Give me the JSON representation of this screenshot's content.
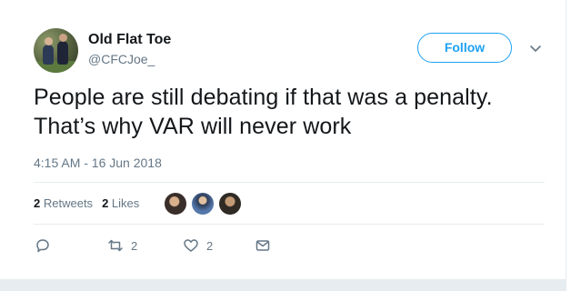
{
  "tweet": {
    "author_name": "Old Flat Toe",
    "author_handle": "@CFCJoe_",
    "follow_label": "Follow",
    "text": "People are still debating if that was a penalty. That’s why VAR will never work",
    "timestamp": "4:15 AM - 16 Jun 2018",
    "stats": {
      "retweets_count": "2",
      "retweets_label": "Retweets",
      "likes_count": "2",
      "likes_label": "Likes"
    },
    "actions": {
      "retweet_count": "2",
      "like_count": "2"
    }
  },
  "icons": {
    "reply": "reply-icon",
    "retweet": "retweet-icon",
    "like": "heart-icon",
    "dm": "envelope-icon",
    "caret": "chevron-down-icon"
  },
  "colors": {
    "accent": "#1da1f2",
    "text": "#14171a",
    "muted": "#657786",
    "divider": "#e6ecf0"
  }
}
